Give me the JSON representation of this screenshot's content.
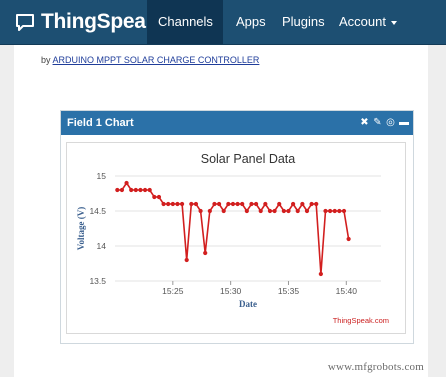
{
  "navbar": {
    "brand": "ThingSpeak",
    "items": [
      {
        "label": "Channels",
        "dropdown": true,
        "active": true
      },
      {
        "label": "Apps",
        "dropdown": false
      },
      {
        "label": "Plugins",
        "dropdown": false
      },
      {
        "label": "Account",
        "dropdown": true
      }
    ]
  },
  "byline": {
    "prefix": "by",
    "link": "ARDUINO MPPT SOLAR CHARGE CONTROLLER"
  },
  "panel": {
    "title": "Field 1 Chart",
    "tools": [
      "close-icon",
      "edit-icon",
      "comment-icon",
      "minimize-icon"
    ]
  },
  "chart_data": {
    "type": "line",
    "title": "Solar Panel Data",
    "xlabel": "Date",
    "ylabel": "Voltage (V)",
    "credit": "ThingSpeak.com",
    "ylim": [
      13.5,
      15
    ],
    "yticks": [
      "15",
      "14.5",
      "14",
      "13.5"
    ],
    "xlim": [
      0,
      23
    ],
    "xticks": [
      {
        "label": "15:25",
        "x": 5
      },
      {
        "label": "15:30",
        "x": 10
      },
      {
        "label": "15:35",
        "x": 15
      },
      {
        "label": "15:40",
        "x": 20
      }
    ],
    "series": [
      {
        "color": "#d21f1f",
        "x": [
          0.2,
          0.6,
          1.0,
          1.4,
          1.8,
          2.2,
          2.6,
          3.0,
          3.4,
          3.8,
          4.2,
          4.6,
          5.0,
          5.4,
          5.8,
          6.2,
          6.6,
          7.0,
          7.4,
          7.8,
          8.2,
          8.6,
          9.0,
          9.4,
          9.8,
          10.2,
          10.6,
          11.0,
          11.4,
          11.8,
          12.2,
          12.6,
          13.0,
          13.4,
          13.8,
          14.2,
          14.6,
          15.0,
          15.4,
          15.8,
          16.2,
          16.6,
          17.0,
          17.4,
          17.8,
          18.2,
          18.6,
          19.0,
          19.4,
          19.8,
          20.2
        ],
        "y": [
          14.8,
          14.8,
          14.9,
          14.8,
          14.8,
          14.8,
          14.8,
          14.8,
          14.7,
          14.7,
          14.6,
          14.6,
          14.6,
          14.6,
          14.6,
          13.8,
          14.6,
          14.6,
          14.5,
          13.9,
          14.5,
          14.6,
          14.6,
          14.5,
          14.6,
          14.6,
          14.6,
          14.6,
          14.5,
          14.6,
          14.6,
          14.5,
          14.6,
          14.5,
          14.5,
          14.6,
          14.5,
          14.5,
          14.6,
          14.5,
          14.6,
          14.5,
          14.6,
          14.6,
          13.6,
          14.5,
          14.5,
          14.5,
          14.5,
          14.5,
          14.1
        ]
      }
    ],
    "grid": true,
    "legend": "none"
  },
  "watermark": "www.mfgrobots.com",
  "colors": {
    "navbar": "#1d4f72",
    "panel_header": "#2b71a8",
    "series": "#d21f1f"
  }
}
